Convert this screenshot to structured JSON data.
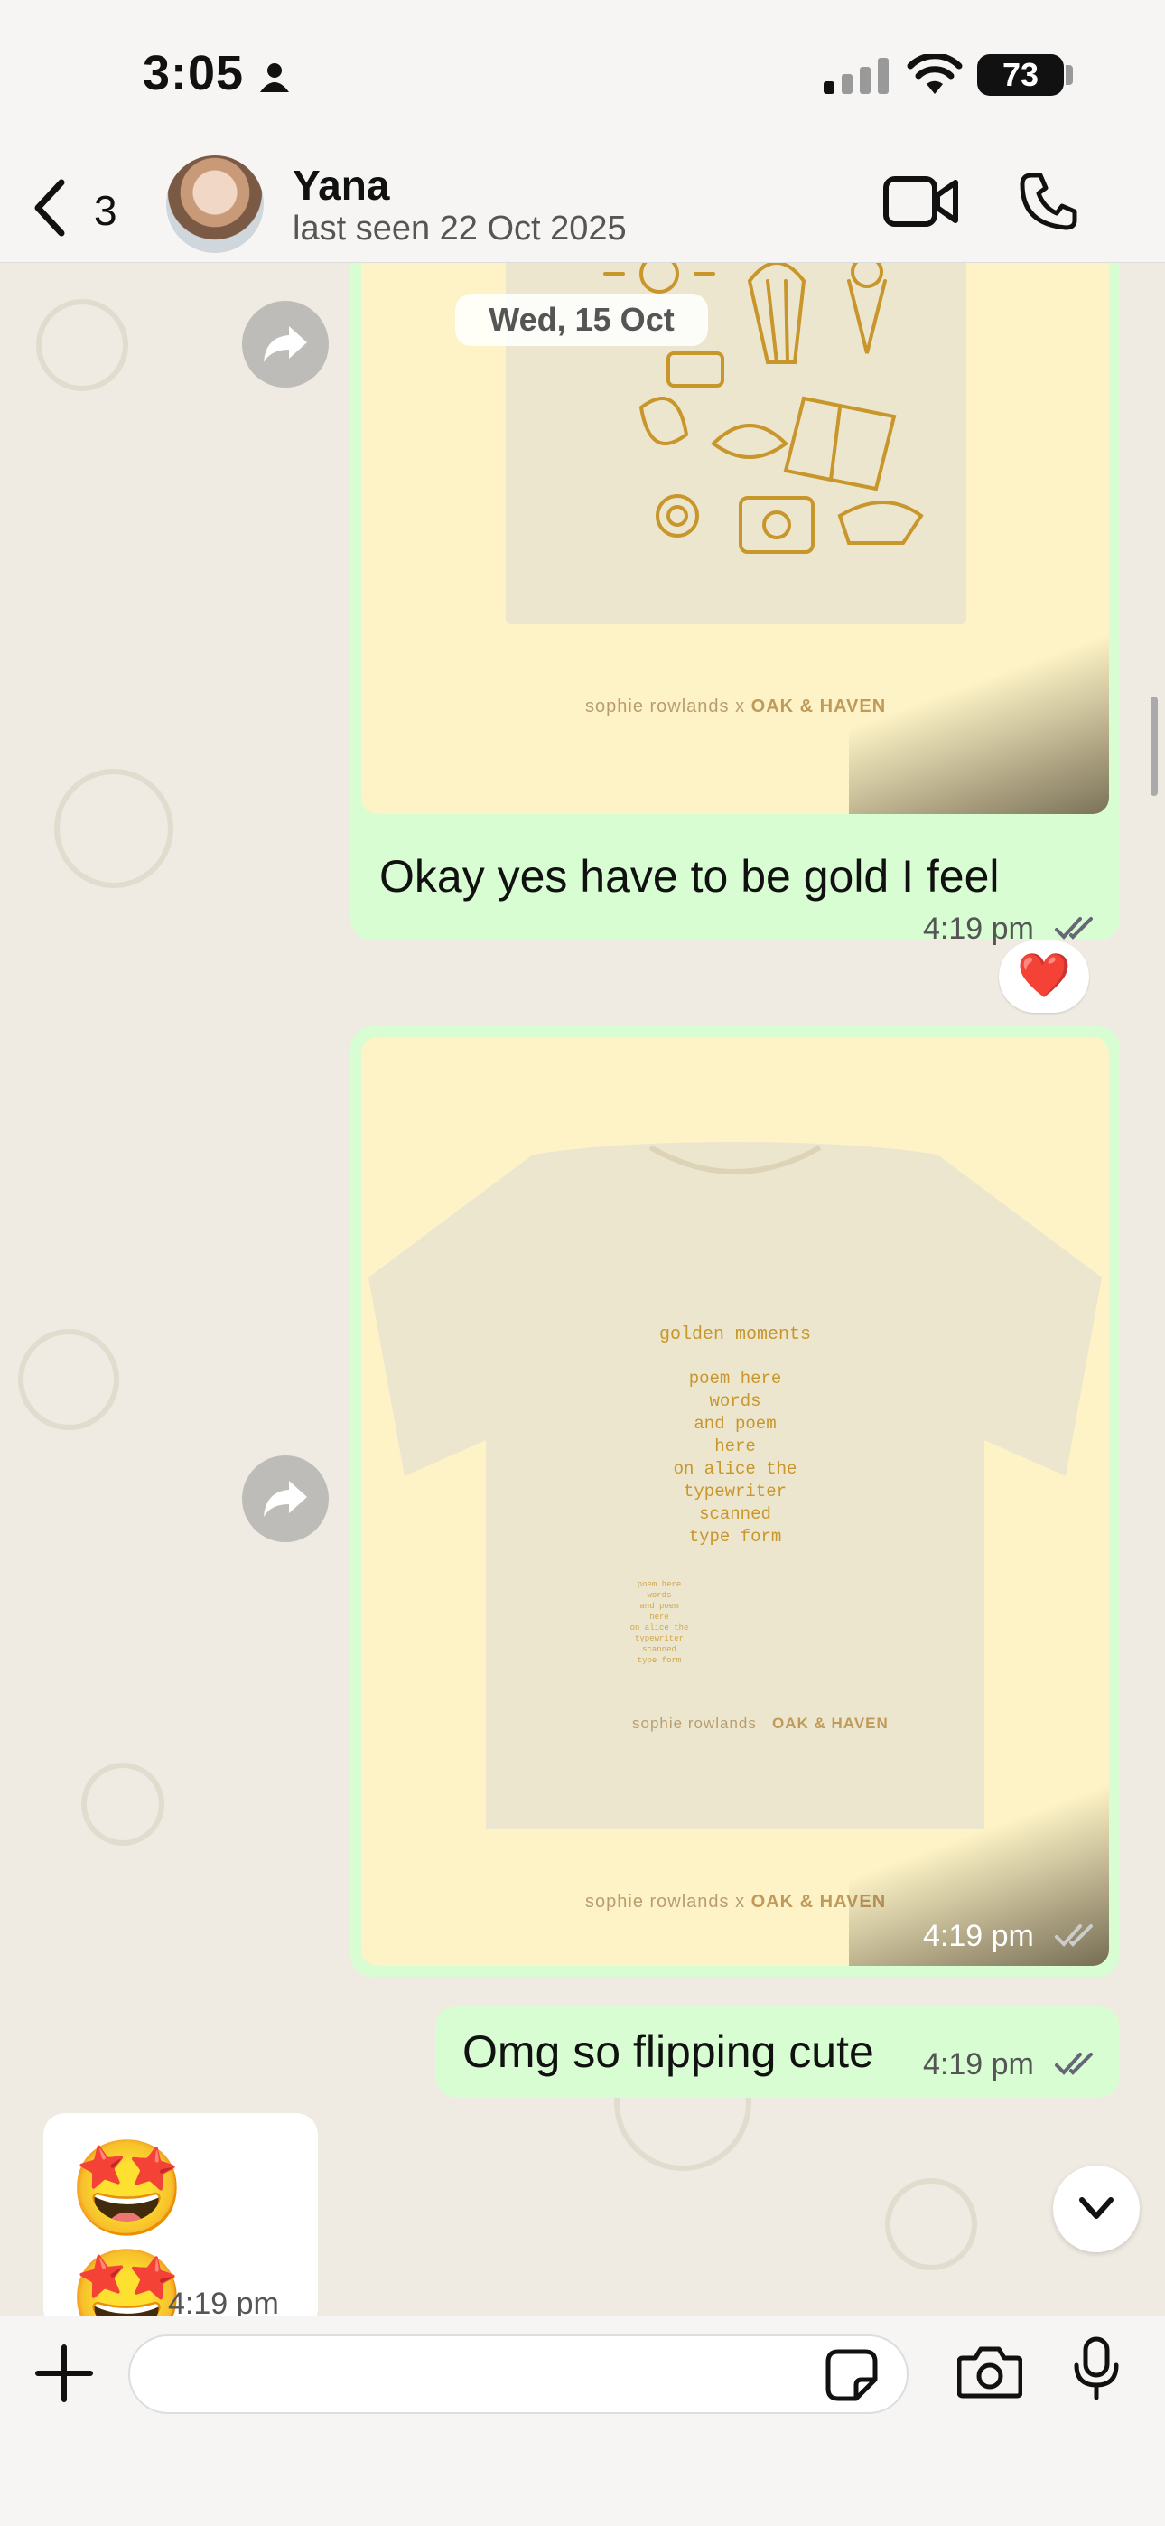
{
  "status_bar": {
    "time": "3:05",
    "battery": "73"
  },
  "header": {
    "back_count": "3",
    "contact_name": "Yana",
    "contact_status": "last seen 22 Oct 2025"
  },
  "chat": {
    "date_chip": "Wed, 15 Oct",
    "messages": [
      {
        "type": "image-with-caption",
        "caption": "Okay yes have to be gold I feel",
        "time": "4:19 pm",
        "brand_left": "sophie rowlands",
        "brand_x": "x",
        "brand_right": "OAK & HAVEN",
        "reaction": "❤️"
      },
      {
        "type": "image",
        "time": "4:19 pm",
        "brand_left": "sophie rowlands",
        "brand_x": "x",
        "brand_right": "OAK & HAVEN",
        "poem_title": "golden moments",
        "poem_body": "poem here\nwords\nand poem\nhere\non alice the\ntypewriter\nscanned\ntype form",
        "tee_brand_left": "sophie rowlands",
        "tee_brand_right": "OAK & HAVEN"
      },
      {
        "type": "text",
        "text": "Omg so flipping cute",
        "time": "4:19 pm"
      },
      {
        "type": "incoming-emoji",
        "emoji": "🤩 🤩",
        "time": "4:19 pm"
      }
    ]
  },
  "composer": {
    "input_value": "",
    "input_placeholder": ""
  },
  "colors": {
    "outgoing_bubble": "#d9fdd3",
    "background": "#efeae2",
    "tick": "#53bdeb"
  }
}
